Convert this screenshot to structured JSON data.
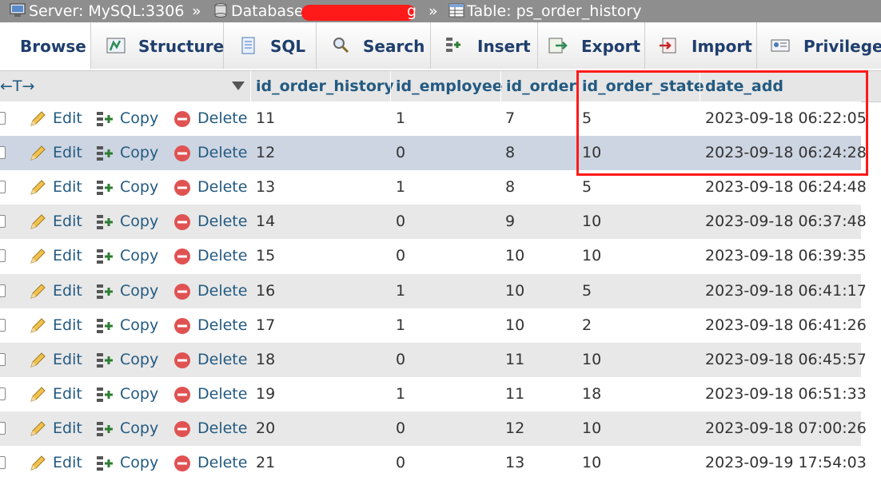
{
  "breadcrumb": {
    "server": "Server: MySQL:3306",
    "sep1": "»",
    "database": "Database: ps",
    "database_tail": "g",
    "sep2": "»",
    "table": "Table: ps_order_history"
  },
  "tabs": [
    {
      "label": "Browse",
      "icon": "browse-icon"
    },
    {
      "label": "Structure",
      "icon": "structure-icon"
    },
    {
      "label": "SQL",
      "icon": "sql-icon"
    },
    {
      "label": "Search",
      "icon": "search-icon"
    },
    {
      "label": "Insert",
      "icon": "insert-icon"
    },
    {
      "label": "Export",
      "icon": "export-icon"
    },
    {
      "label": "Import",
      "icon": "import-icon"
    },
    {
      "label": "Privileges",
      "icon": "privileges-icon"
    }
  ],
  "table": {
    "expand_arrows": "←T→",
    "columns": [
      "id_order_history",
      "id_employee",
      "id_order",
      "id_order_state",
      "date_add"
    ],
    "actions": {
      "edit": "Edit",
      "copy": "Copy",
      "delete": "Delete"
    },
    "rows": [
      [
        "11",
        "1",
        "7",
        "5",
        "2023-09-18 06:22:05"
      ],
      [
        "12",
        "0",
        "8",
        "10",
        "2023-09-18 06:24:28"
      ],
      [
        "13",
        "1",
        "8",
        "5",
        "2023-09-18 06:24:48"
      ],
      [
        "14",
        "0",
        "9",
        "10",
        "2023-09-18 06:37:48"
      ],
      [
        "15",
        "0",
        "10",
        "10",
        "2023-09-18 06:39:35"
      ],
      [
        "16",
        "1",
        "10",
        "5",
        "2023-09-18 06:41:17"
      ],
      [
        "17",
        "1",
        "10",
        "2",
        "2023-09-18 06:41:26"
      ],
      [
        "18",
        "0",
        "11",
        "10",
        "2023-09-18 06:45:57"
      ],
      [
        "19",
        "1",
        "11",
        "18",
        "2023-09-18 06:51:33"
      ],
      [
        "20",
        "0",
        "12",
        "10",
        "2023-09-18 07:00:26"
      ],
      [
        "21",
        "0",
        "13",
        "10",
        "2023-09-19 17:54:03"
      ]
    ]
  },
  "colors": {
    "accent": "#235a81",
    "highlight_box": "#ff1a1a",
    "selected_row": "#cdd5e2"
  }
}
